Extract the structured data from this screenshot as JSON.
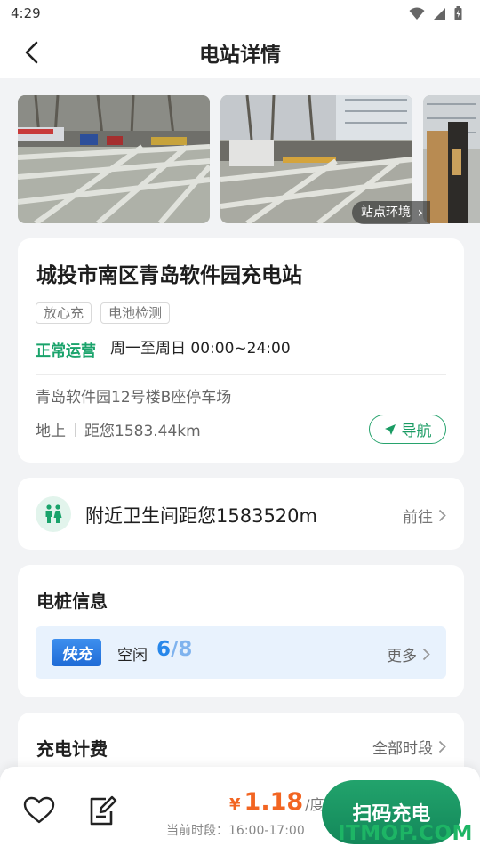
{
  "status_bar": {
    "time": "4:29",
    "icons": [
      "wifi-icon",
      "signal-icon",
      "battery-icon"
    ]
  },
  "header": {
    "title": "电站详情",
    "back_icon": "chevron-left-icon"
  },
  "gallery": {
    "env_label": "站点环境"
  },
  "station": {
    "name": "城投市南区青岛软件园充电站",
    "tags": [
      "放心充",
      "电池检测"
    ],
    "status": "正常运营",
    "hours": "周一至周日 00:00~24:00",
    "address": "青岛软件园12号楼B座停车场",
    "location_type": "地上",
    "distance": "距您1583.44km",
    "nav_label": "导航"
  },
  "toilet": {
    "text": "附近卫生间距您1583520m",
    "goto_label": "前往"
  },
  "piles": {
    "title": "电桩信息",
    "type_badge": "快充",
    "idle_label": "空闲",
    "idle_available": "6",
    "idle_total": "/8",
    "more_label": "更多"
  },
  "billing": {
    "title": "充电计费",
    "all_periods_label": "全部时段"
  },
  "bottom_bar": {
    "currency": "¥",
    "price": "1.18",
    "unit": "/度",
    "period": "当前时段：16:00-17:00",
    "scan_label": "扫码充电"
  },
  "watermark": "ITMOP.COM",
  "colors": {
    "accent_green": "#1aa36b",
    "price_orange": "#f26522",
    "fast_blue": "#2787ea"
  }
}
